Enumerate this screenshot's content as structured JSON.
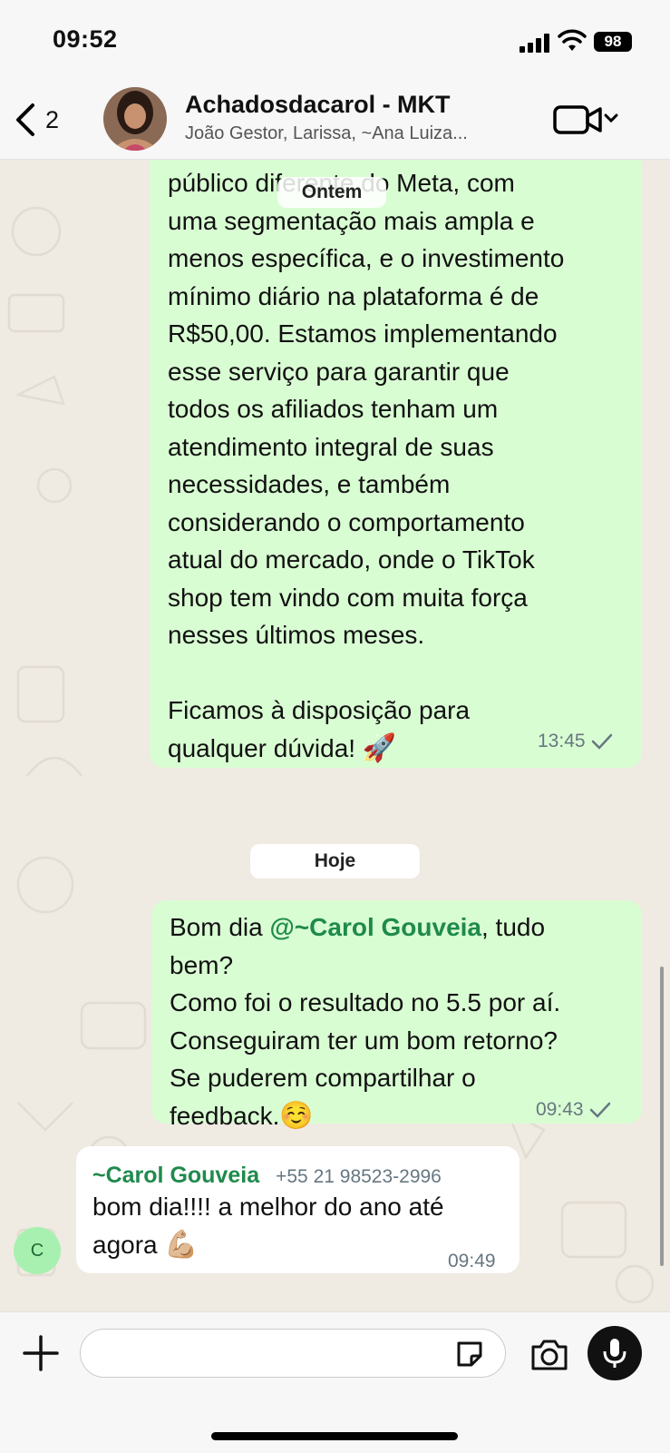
{
  "status_bar": {
    "time": "09:52",
    "battery": "98"
  },
  "header": {
    "back_count": "2",
    "title": "Achadosdacarol - MKT",
    "members": "João Gestor, Larissa, ~Ana Luiza..."
  },
  "chat": {
    "date_sticky": "Ontem",
    "date_today": "Hoje",
    "messages": [
      {
        "direction": "outgoing",
        "text": "público diferente do Meta, com\numa segmentação mais ampla e\nmenos específica, e o investimento\nmínimo diário na plataforma é de\nR$50,00. Estamos implementando\nesse serviço para garantir que\ntodos os afiliados tenham um\natendimento integral de suas\nnecessidades, e também\nconsiderando o comportamento\natual do mercado, onde o TikTok\nshop tem vindo com muita força\nnesses últimos meses.\n\nFicamos à disposição para\nqualquer dúvida!",
        "emoji": "🚀",
        "time": "13:45"
      },
      {
        "direction": "outgoing",
        "text_prefix": "Bom dia ",
        "mention": "@~Carol Gouveia",
        "text_suffix": ", tudo\nbem?\nComo foi o resultado no 5.5 por aí.\nConseguiram ter um bom retorno?\nSe puderem compartilhar o\nfeedback.",
        "emoji": "☺️",
        "time": "09:43"
      },
      {
        "direction": "incoming",
        "sender": "~Carol Gouveia",
        "phone": "+55 21 98523-2996",
        "avatar_initial": "C",
        "text": "bom dia!!!! a melhor do ano até\nagora",
        "emoji": "💪🏼",
        "time": "09:49"
      }
    ]
  },
  "composer": {
    "placeholder": ""
  },
  "colors": {
    "outgoing_bubble": "#d9fdd3",
    "incoming_bubble": "#ffffff",
    "mention": "#1f8a4c",
    "chat_background": "#efeae2"
  },
  "icons": [
    "signal-icon",
    "wifi-icon",
    "chevron-left-icon",
    "video-camera-icon",
    "chevron-down-icon",
    "checkmark-icon",
    "plus-icon",
    "sticker-icon",
    "camera-icon",
    "microphone-icon",
    "rocket-emoji",
    "smiling-emoji",
    "flexed-biceps-emoji"
  ]
}
